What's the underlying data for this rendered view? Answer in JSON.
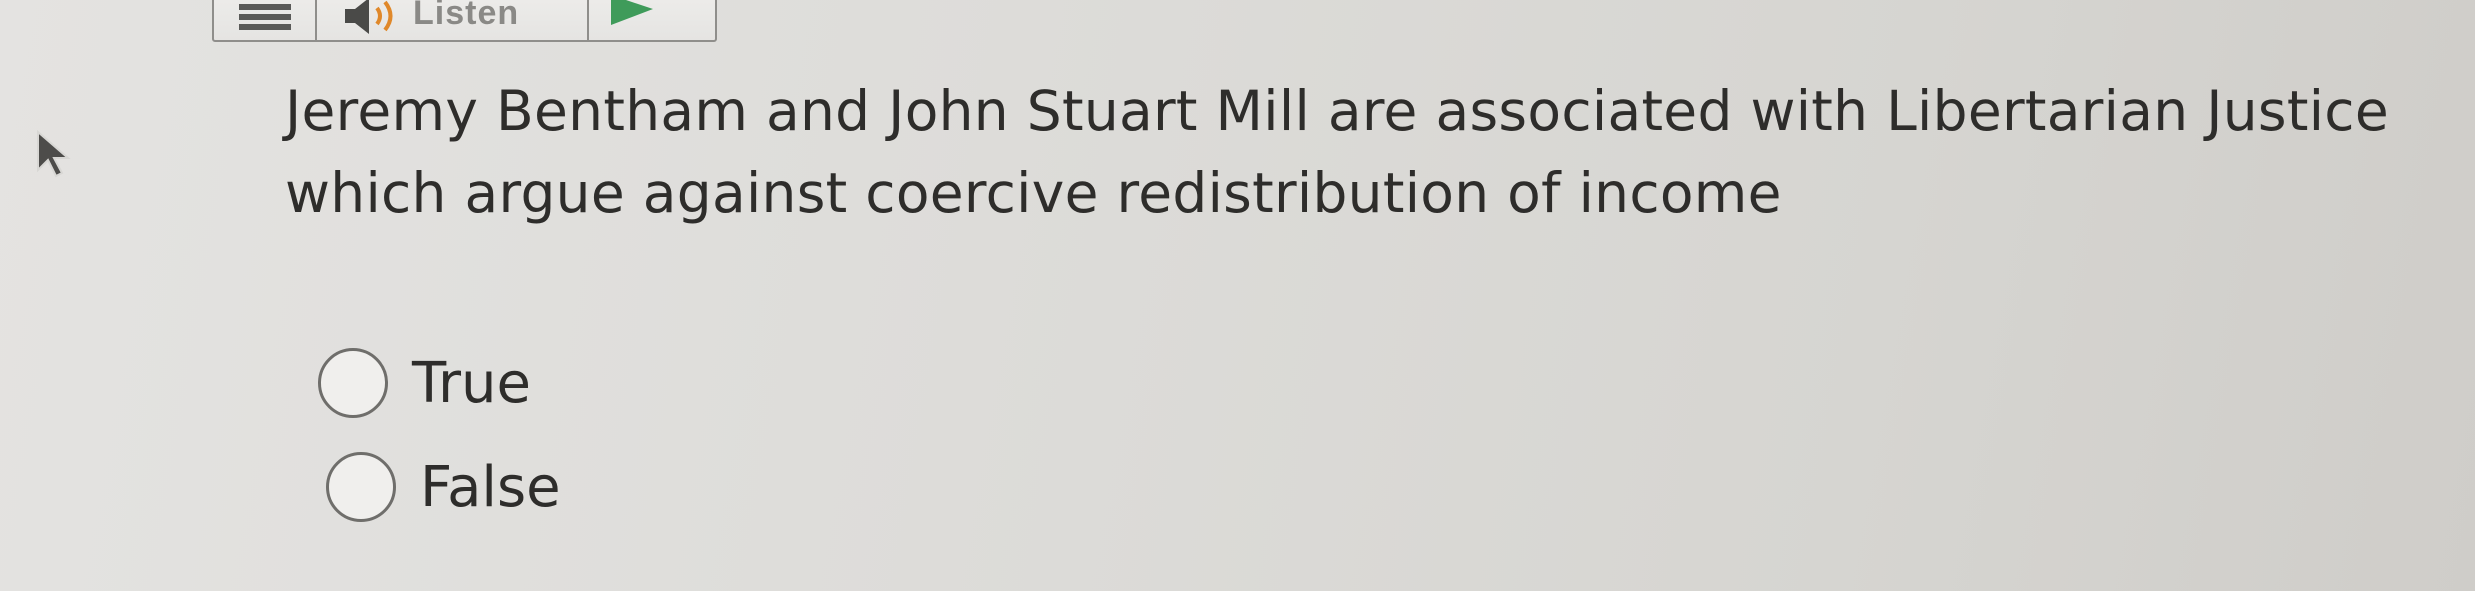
{
  "toolbar": {
    "listen_label": "Listen",
    "icons": [
      "menu-icon",
      "speaker-icon",
      "play-icon"
    ]
  },
  "question": {
    "text": "Jeremy Bentham and John Stuart Mill are associated with Libertarian Justice which argue against coercive redistribution of income"
  },
  "options": [
    {
      "label": "True",
      "selected": false
    },
    {
      "label": "False",
      "selected": false
    }
  ],
  "colors": {
    "text": "#2e2d2b",
    "radio_border": "#6f6e6b",
    "play_green": "#3f9b5a"
  }
}
